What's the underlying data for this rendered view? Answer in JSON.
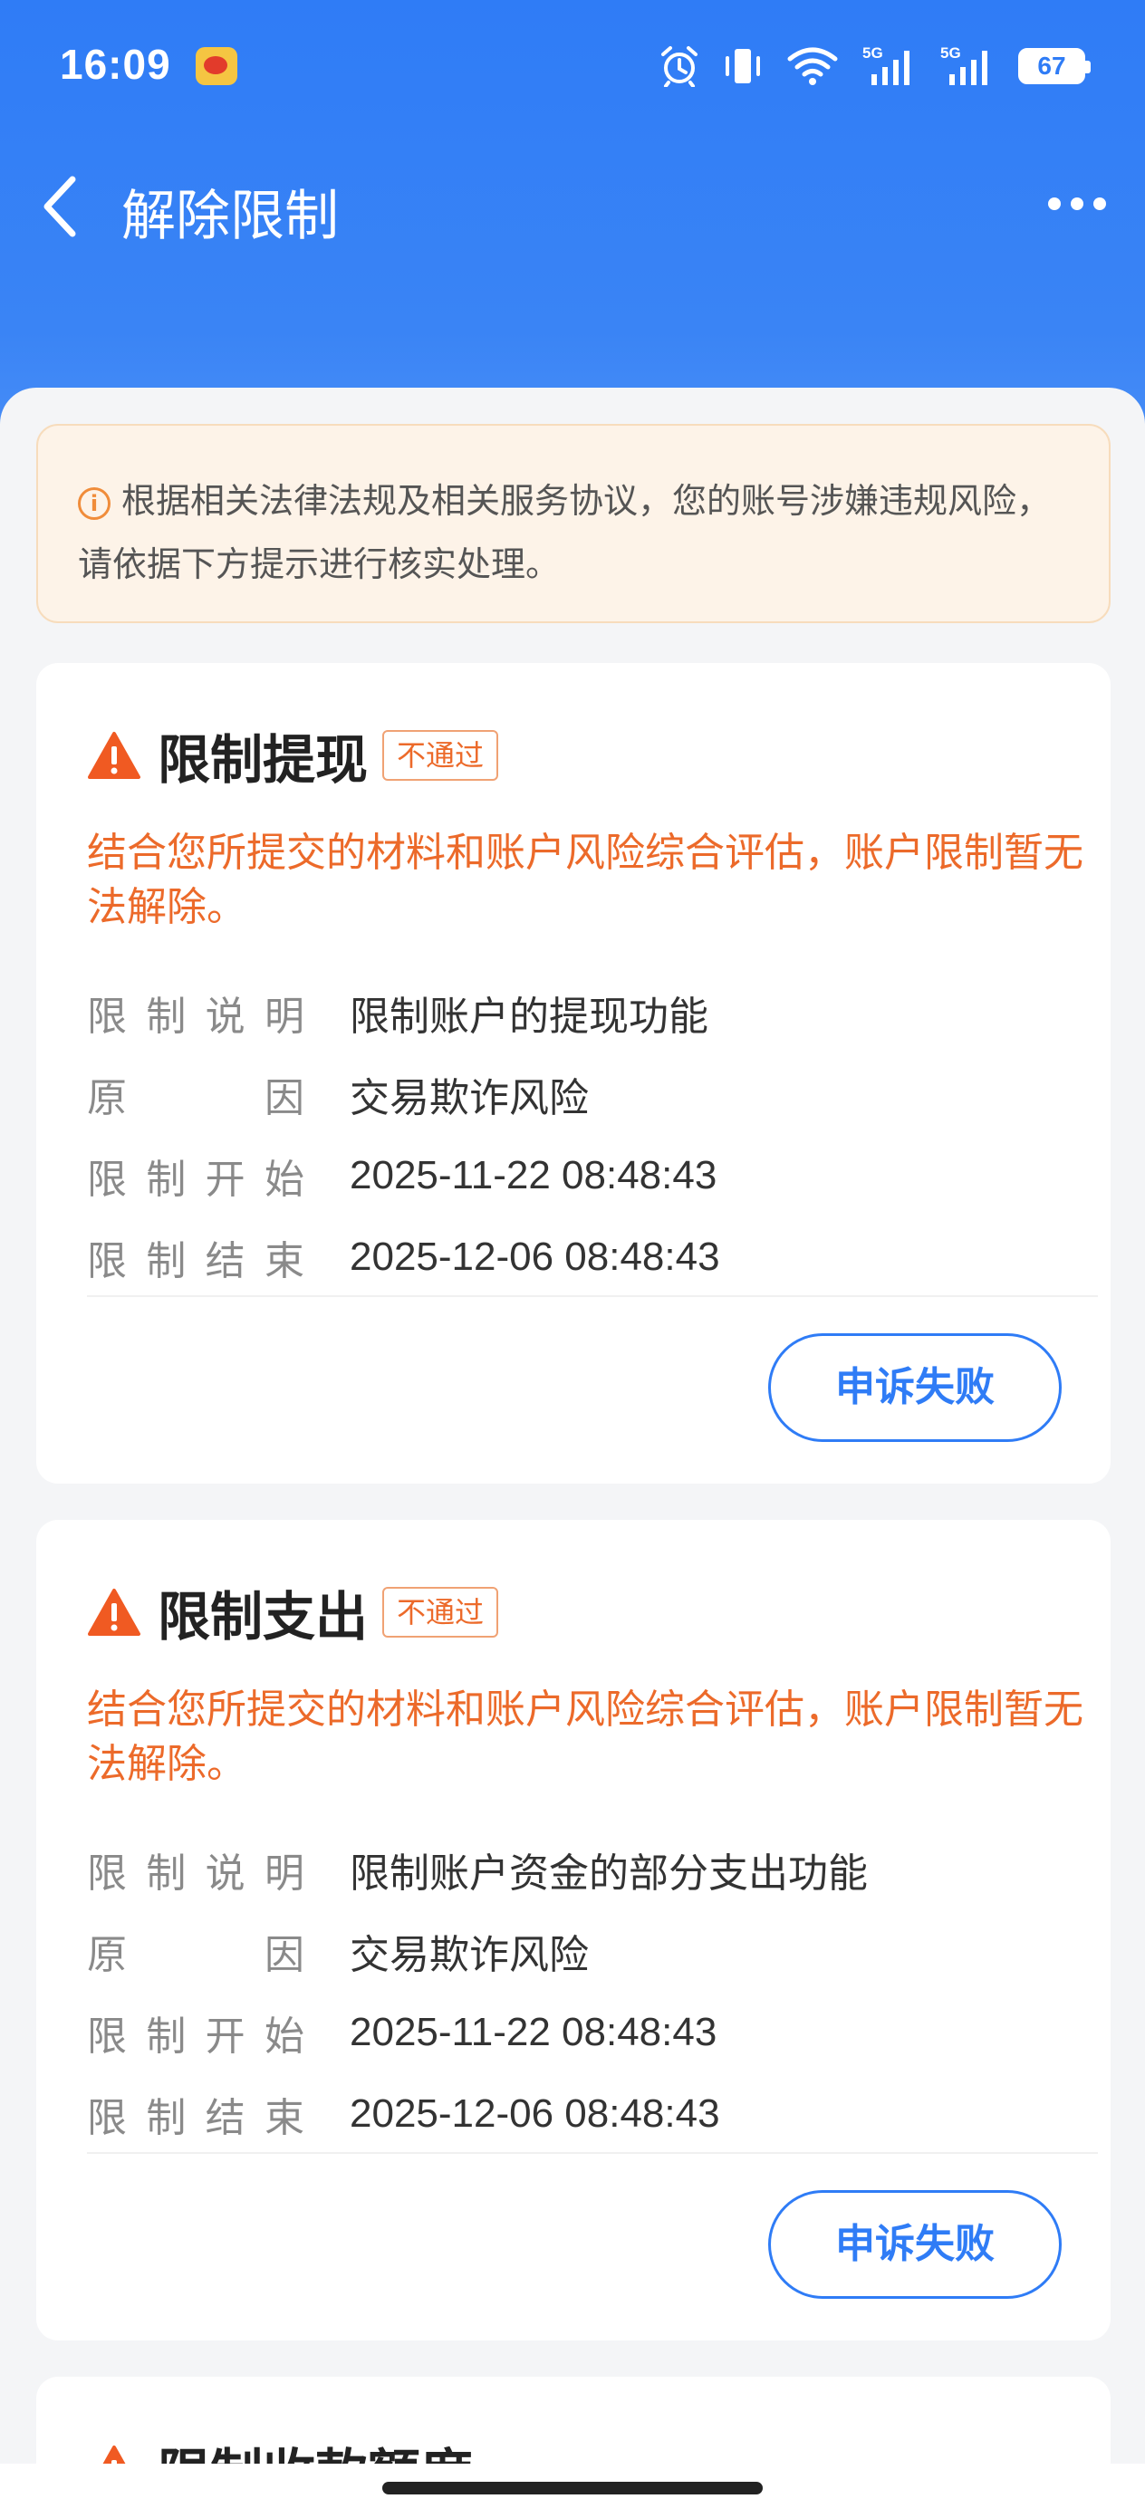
{
  "status_bar": {
    "time": "16:09",
    "battery": "67",
    "icons": [
      "weibo-icon",
      "alarm-icon",
      "vibrate-icon",
      "wifi-icon",
      "signal-5g-icon",
      "signal-5g-icon",
      "battery-icon"
    ]
  },
  "nav": {
    "title": "解除限制",
    "back_icon": "chevron-left-icon",
    "more_icon": "more-dots-icon"
  },
  "notice": {
    "text": "根据相关法律法规及相关服务协议，您的账号涉嫌违规风险，请依据下方提示进行核实处理。"
  },
  "labels": {
    "desc": [
      "限",
      "制",
      "说",
      "明"
    ],
    "reason": [
      "原",
      "因"
    ],
    "start": [
      "限",
      "制",
      "开",
      "始"
    ],
    "end": [
      "限",
      "制",
      "结",
      "束"
    ]
  },
  "cards": [
    {
      "title": "限制提现",
      "badge": "不通过",
      "warning": "结合您所提交的材料和账户风险综合评估，账户限制暂无法解除。",
      "desc": "限制账户的提现功能",
      "reason": "交易欺诈风险",
      "start": "2025-11-22 08:48:43",
      "end": "2025-12-06 08:48:43",
      "button": "申诉失败"
    },
    {
      "title": "限制支出",
      "badge": "不通过",
      "warning": "结合您所提交的材料和账户风险综合评估，账户限制暂无法解除。",
      "desc": "限制账户资金的部分支出功能",
      "reason": "交易欺诈风险",
      "start": "2025-11-22 08:48:43",
      "end": "2025-12-06 08:48:43",
      "button": "申诉失败"
    },
    {
      "title": "限制收款额度"
    }
  ],
  "colors": {
    "header_blue": "#2f7cf6",
    "warning_orange": "#ec6a2a",
    "notice_bg": "#fdf3e8"
  }
}
